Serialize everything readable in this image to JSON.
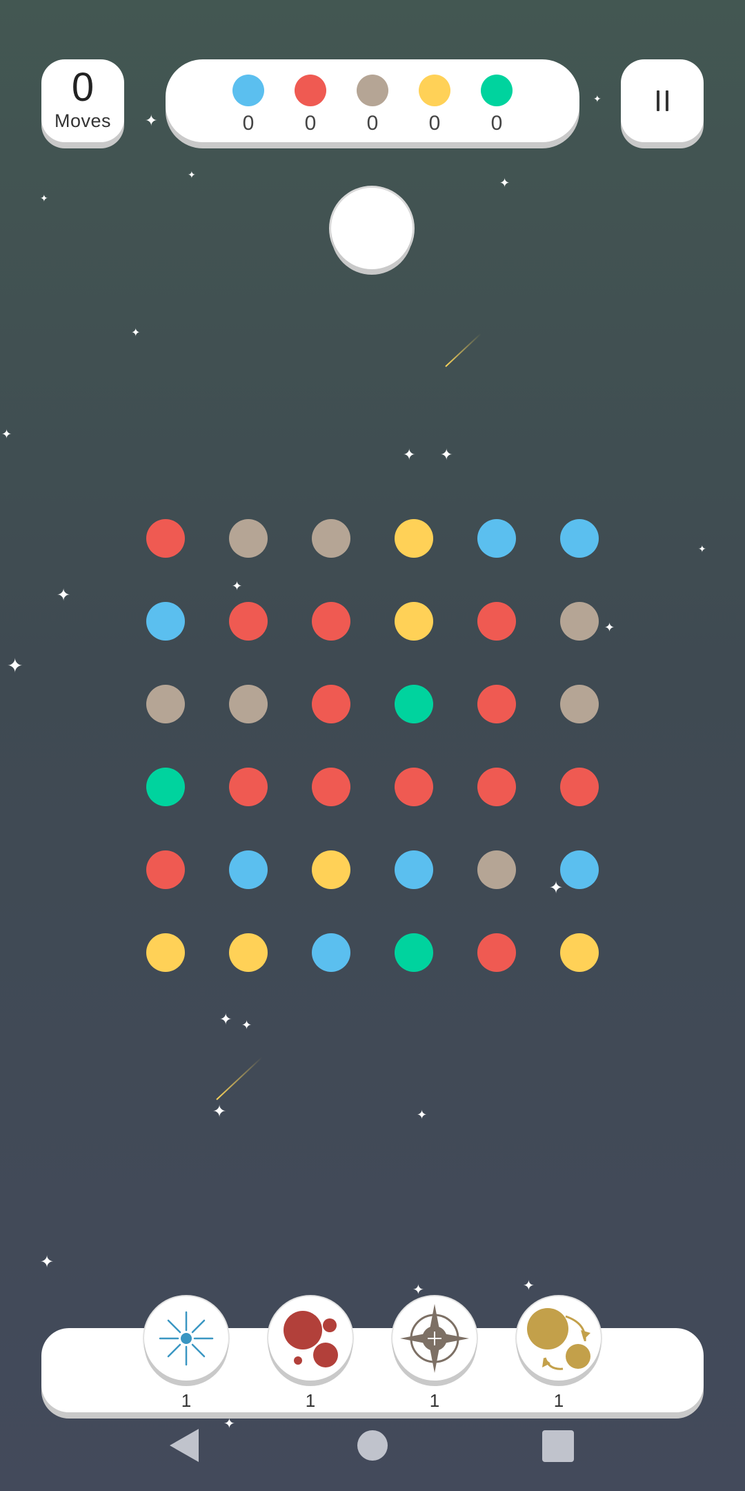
{
  "header": {
    "moves_value": "0",
    "moves_label": "Moves",
    "goals": [
      {
        "color": "#5bbfef",
        "count": "0"
      },
      {
        "color": "#ef5a52",
        "count": "0"
      },
      {
        "color": "#b5a595",
        "count": "0"
      },
      {
        "color": "#ffd157",
        "count": "0"
      },
      {
        "color": "#00d39e",
        "count": "0"
      }
    ]
  },
  "colors": {
    "blue": "#5bbfef",
    "red": "#ef5a52",
    "tan": "#b5a595",
    "yellow": "#ffd157",
    "green": "#00d39e"
  },
  "board": [
    [
      "red",
      "tan",
      "tan",
      "yellow",
      "blue",
      "blue"
    ],
    [
      "blue",
      "red",
      "red",
      "yellow",
      "red",
      "tan"
    ],
    [
      "tan",
      "tan",
      "red",
      "green",
      "red",
      "tan"
    ],
    [
      "green",
      "red",
      "red",
      "red",
      "red",
      "red"
    ],
    [
      "red",
      "blue",
      "yellow",
      "blue",
      "tan",
      "blue"
    ],
    [
      "yellow",
      "yellow",
      "blue",
      "green",
      "red",
      "yellow"
    ]
  ],
  "powerups": [
    {
      "icon": "expander-icon",
      "count": "1"
    },
    {
      "icon": "shrinker-icon",
      "count": "1"
    },
    {
      "icon": "compass-icon",
      "count": "1"
    },
    {
      "icon": "swap-icon",
      "count": "1"
    }
  ],
  "navigation": [
    "back-icon",
    "home-icon",
    "recents-icon"
  ]
}
